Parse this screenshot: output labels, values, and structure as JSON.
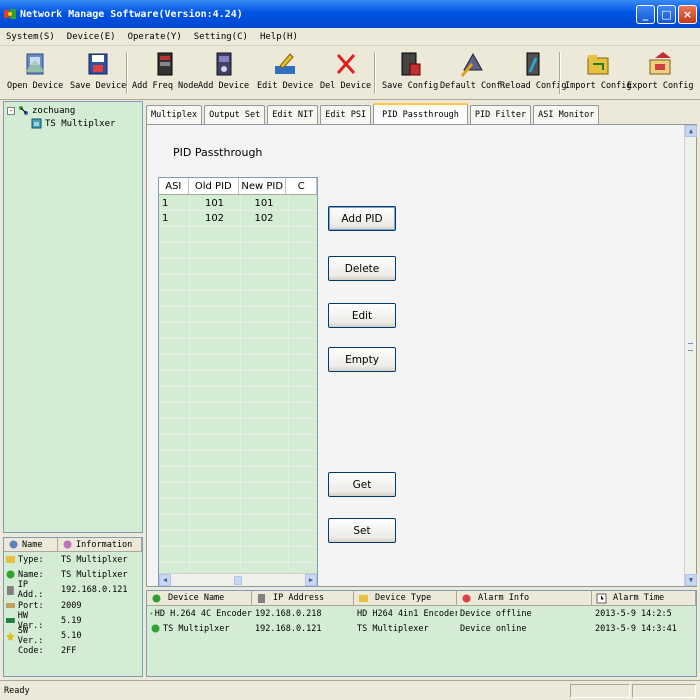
{
  "window": {
    "title": "Network Manage Software(Version:4.24)",
    "controls": {
      "minimize": "_",
      "maximize": "□",
      "close": "×"
    }
  },
  "menu": [
    "System(S)",
    "Device(E)",
    "Operate(Y)",
    "Setting(C)",
    "Help(H)"
  ],
  "toolbar": [
    {
      "label": "Open Device",
      "icon": "open-device-icon"
    },
    {
      "label": "Save Device",
      "icon": "save-device-icon"
    },
    {
      "label": "Add Freq Node",
      "icon": "add-freq-node-icon"
    },
    {
      "label": "Add Device",
      "icon": "add-device-icon"
    },
    {
      "label": "Edit Device",
      "icon": "edit-device-icon"
    },
    {
      "label": "Del Device",
      "icon": "delete-icon"
    },
    {
      "label": "Save Config",
      "icon": "save-config-icon"
    },
    {
      "label": "Default Conf.",
      "icon": "default-config-icon"
    },
    {
      "label": "Reload Config",
      "icon": "reload-config-icon"
    },
    {
      "label": "Import Config",
      "icon": "import-config-icon"
    },
    {
      "label": "Export Config",
      "icon": "export-config-icon"
    }
  ],
  "tree": {
    "root": {
      "expander": "-",
      "label": "zochuang"
    },
    "child": {
      "label": "TS Multiplxer"
    }
  },
  "info": {
    "headers": {
      "name": "Name",
      "information": "Information"
    },
    "rows": [
      {
        "key": "Type:",
        "value": "TS Multiplxer"
      },
      {
        "key": "Name:",
        "value": "TS Multiplxer"
      },
      {
        "key": "IP Add.:",
        "value": "192.168.0.121"
      },
      {
        "key": "Port:",
        "value": "2009"
      },
      {
        "key": "HW Ver.:",
        "value": "5.19"
      },
      {
        "key": "SW Ver.:",
        "value": "5.10"
      },
      {
        "key": "Code:",
        "value": "2FF"
      }
    ]
  },
  "tabs": [
    "Multiplex",
    "Output Set",
    "Edit NIT",
    "Edit PSI",
    "PID Passthrough",
    "PID Filter",
    "ASI Monitor"
  ],
  "active_tab": "PID Passthrough",
  "pid": {
    "section_title": "PID Passthrough",
    "columns": [
      "ASI",
      "Old PID",
      "New PID",
      "C"
    ],
    "rows": [
      [
        "1",
        "101",
        "101",
        ""
      ],
      [
        "1",
        "102",
        "102",
        ""
      ]
    ]
  },
  "buttons": {
    "add_pid": "Add PID",
    "delete": "Delete",
    "edit": "Edit",
    "empty": "Empty",
    "get": "Get",
    "set": "Set"
  },
  "alarm": {
    "columns": [
      "Device Name",
      "IP Address",
      "Device Type",
      "Alarm Info",
      "Alarm Time"
    ],
    "rows": [
      {
        "name": "HD H.264 4C Encoder",
        "ip": "192.168.0.218",
        "type": "HD H264 4in1 Encoder",
        "info": "Device offline",
        "time": "2013-5-9 14:2:5"
      },
      {
        "name": "TS Multiplxer",
        "ip": "192.168.0.121",
        "type": "TS Multiplexer",
        "info": "Device online",
        "time": "2013-5-9 14:3:41"
      }
    ]
  },
  "status": {
    "text": "Ready"
  },
  "colors": {
    "title_bar": "#0054e3",
    "panel_green": "#d4ecd4",
    "chrome": "#ece9d8",
    "active_tab_accent": "#ffc83c"
  }
}
